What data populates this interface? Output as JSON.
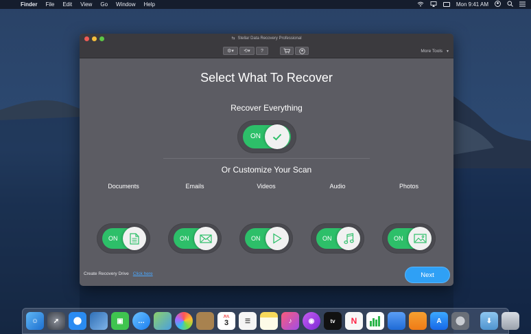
{
  "menubar": {
    "app_name": "Finder",
    "items": [
      "File",
      "Edit",
      "View",
      "Go",
      "Window",
      "Help"
    ],
    "clock": "Mon 9:41 AM"
  },
  "window": {
    "title": "Stellar Data Recovery Professional",
    "toolbar": {
      "more_tools_label": "More Tools",
      "help_label": "?"
    },
    "heading": "Select What To Recover",
    "recover_everything": {
      "label": "Recover Everything",
      "state": "ON"
    },
    "customize_heading": "Or Customize Your Scan",
    "categories": [
      {
        "label": "Documents",
        "state": "ON",
        "icon": "document-icon"
      },
      {
        "label": "Emails",
        "state": "ON",
        "icon": "envelope-icon"
      },
      {
        "label": "Videos",
        "state": "ON",
        "icon": "play-icon"
      },
      {
        "label": "Audio",
        "state": "ON",
        "icon": "music-note-icon"
      },
      {
        "label": "Photos",
        "state": "ON",
        "icon": "image-icon"
      }
    ],
    "footer": {
      "recovery_drive_label": "Create Recovery Drive",
      "click_here_label": "Click here"
    },
    "next_label": "Next"
  },
  "dock": {
    "calendar_day": "3",
    "calendar_month": "JUL",
    "apple_tv_label": "tv"
  },
  "colors": {
    "toggle_on": "#2dbf69",
    "next_button": "#2fa0f5",
    "link": "#4aa8ff",
    "window_bg": "#5c5c63"
  }
}
